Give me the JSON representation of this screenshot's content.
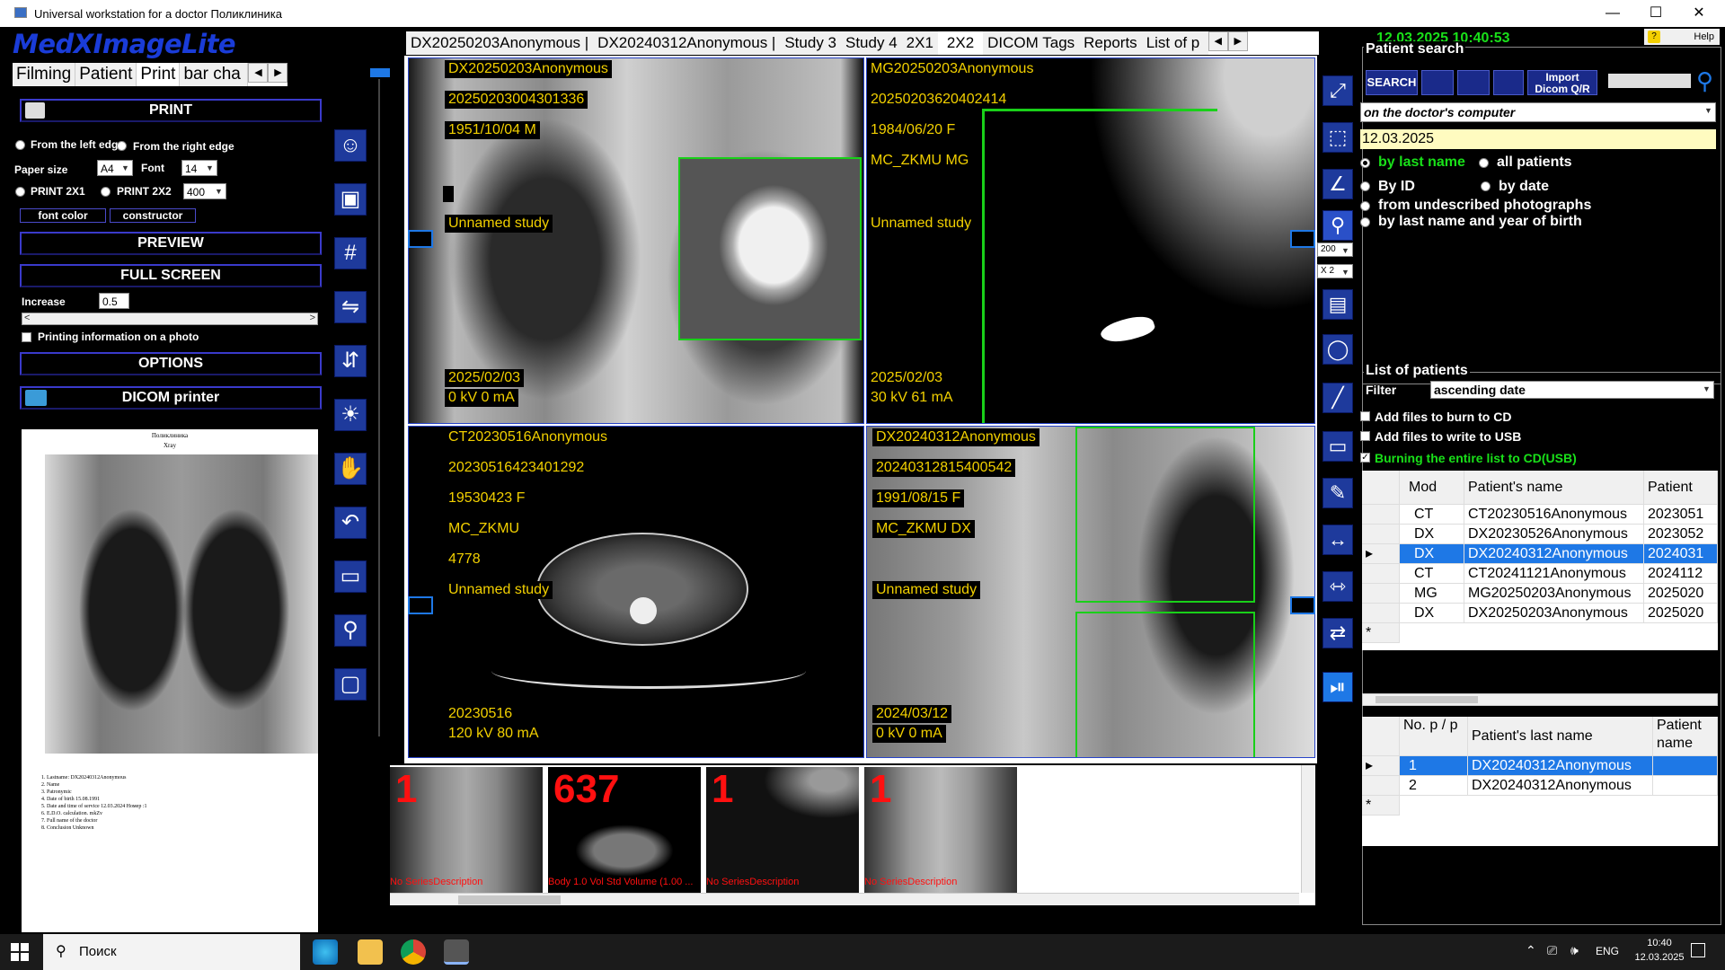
{
  "window": {
    "title": "Universal workstation for a doctor  Поликлиника",
    "minimize": "—",
    "maximize": "☐",
    "close": "✕"
  },
  "app": {
    "logo": "MedXImageLite"
  },
  "left_tabs": [
    "Filming",
    "Patient",
    "Print",
    "bar cha"
  ],
  "print_panel": {
    "print_btn": "PRINT",
    "from_left": "From the left edg",
    "from_right": "From the right edge",
    "paper_size_label": "Paper size",
    "paper_size": "A4",
    "font_label": "Font",
    "font": "14",
    "print2x1": "PRINT 2X1",
    "print2x2": "PRINT 2X2",
    "resolution": "400",
    "font_color": "font color",
    "constructor": "constructor",
    "preview": "PREVIEW",
    "full_screen": "FULL SCREEN",
    "increase_label": "Increase",
    "increase": "0.5",
    "printing_info": "Printing information on a photo",
    "options": "OPTIONS",
    "dicom_printer": "DICOM printer"
  },
  "preview_doc": {
    "header1": "Поликлиника",
    "header2": "Xray",
    "lines": [
      "1. Lastname: DX20240312Anonymous",
      "2. Name",
      "3. Patronymic",
      "4. Date of birth 15.08.1991",
      "5. Date and time of service 12.03.2024  Номер :1",
      "6. E.D.O. calculation.  mkZv",
      "7. Full name of the doctor",
      "8. Conclusion Unknown"
    ]
  },
  "study_tabs": [
    "DX20250203Anonymous |",
    "DX20240312Anonymous |",
    "Study 3",
    "Study 4",
    "2X1",
    "2X2",
    "DICOM Tags",
    "Reports",
    "List of p"
  ],
  "viewports": [
    {
      "name": "DX20250203Anonymous",
      "id": "20250203004301336",
      "dob": "1951/10/04   M",
      "inst": "",
      "extra": "",
      "study": "Unnamed study",
      "date": "2025/02/03",
      "params": "0  kV   0  mA"
    },
    {
      "name": "MG20250203Anonymous",
      "id": "20250203620402414",
      "dob": "1984/06/20   F",
      "inst": "MC_ZKMU MG",
      "extra": "",
      "study": "Unnamed study",
      "date": "2025/02/03",
      "params": "30 kV   61 mA"
    },
    {
      "name": "CT20230516Anonymous",
      "id": "20230516423401292",
      "dob": "19530423  F",
      "inst": "MC_ZKMU",
      "extra": "4778",
      "study": "Unnamed study",
      "date": "20230516",
      "params": "120 kV  80 mA"
    },
    {
      "name": "DX20240312Anonymous",
      "id": "20240312815400542",
      "dob": "1991/08/15   F",
      "inst": "MC_ZKMU DX",
      "extra": "",
      "study": "Unnamed study",
      "date": "2024/03/12",
      "params": "0  kV   0  mA"
    }
  ],
  "thumbnails": [
    {
      "count": "1",
      "desc": "No SeriesDescription"
    },
    {
      "count": "637",
      "desc": "Body 1.0   Vol Std  Volume (1.00 ..."
    },
    {
      "count": "1",
      "desc": "No SeriesDescription"
    },
    {
      "count": "1",
      "desc": "No SeriesDescription"
    }
  ],
  "zoom_value": "200",
  "scale_value": "X 2",
  "right": {
    "datetime": "12.03.2025 10:40:53",
    "help": "Help",
    "patient_search": "Patient search",
    "search_btn": "SEARCH",
    "import_btn": "Import Dicom Q/R",
    "source": "on the doctor's computer",
    "date": "12.03.2025",
    "by_last_name": "by last name",
    "all_patients": "all patients",
    "by_id": "By ID",
    "by_date": "by date",
    "from_undescribed": "from undescribed photographs",
    "by_last_name_year": "by last name and year of birth",
    "list_of_patients": "List of patients",
    "filter_label": "Filter",
    "filter": "ascending date",
    "burn_cd": "Add files to burn to CD",
    "write_usb": "Add files to write to USB",
    "burn_all": "Burning the entire list to CD(USB)",
    "grid1_headers": [
      "Mod",
      "Patient's name",
      "Patient"
    ],
    "grid1_rows": [
      [
        "CT",
        "CT20230516Anonymous",
        "2023051"
      ],
      [
        "DX",
        "DX20230526Anonymous",
        "2023052"
      ],
      [
        "DX",
        "DX20240312Anonymous",
        "2024031"
      ],
      [
        "CT",
        "CT20241121Anonymous",
        "2024112"
      ],
      [
        "MG",
        "MG20250203Anonymous",
        "2025020"
      ],
      [
        "DX",
        "DX20250203Anonymous",
        "2025020"
      ]
    ],
    "grid2_headers": [
      "No. p / p",
      "Patient's last name",
      "Patient name"
    ],
    "grid2_rows": [
      [
        "1",
        "DX20240312Anonymous",
        ""
      ],
      [
        "2",
        "DX20240312Anonymous",
        ""
      ]
    ]
  },
  "taskbar": {
    "search": "Поиск",
    "lang": "ENG",
    "time": "10:40",
    "date": "12.03.2025"
  }
}
